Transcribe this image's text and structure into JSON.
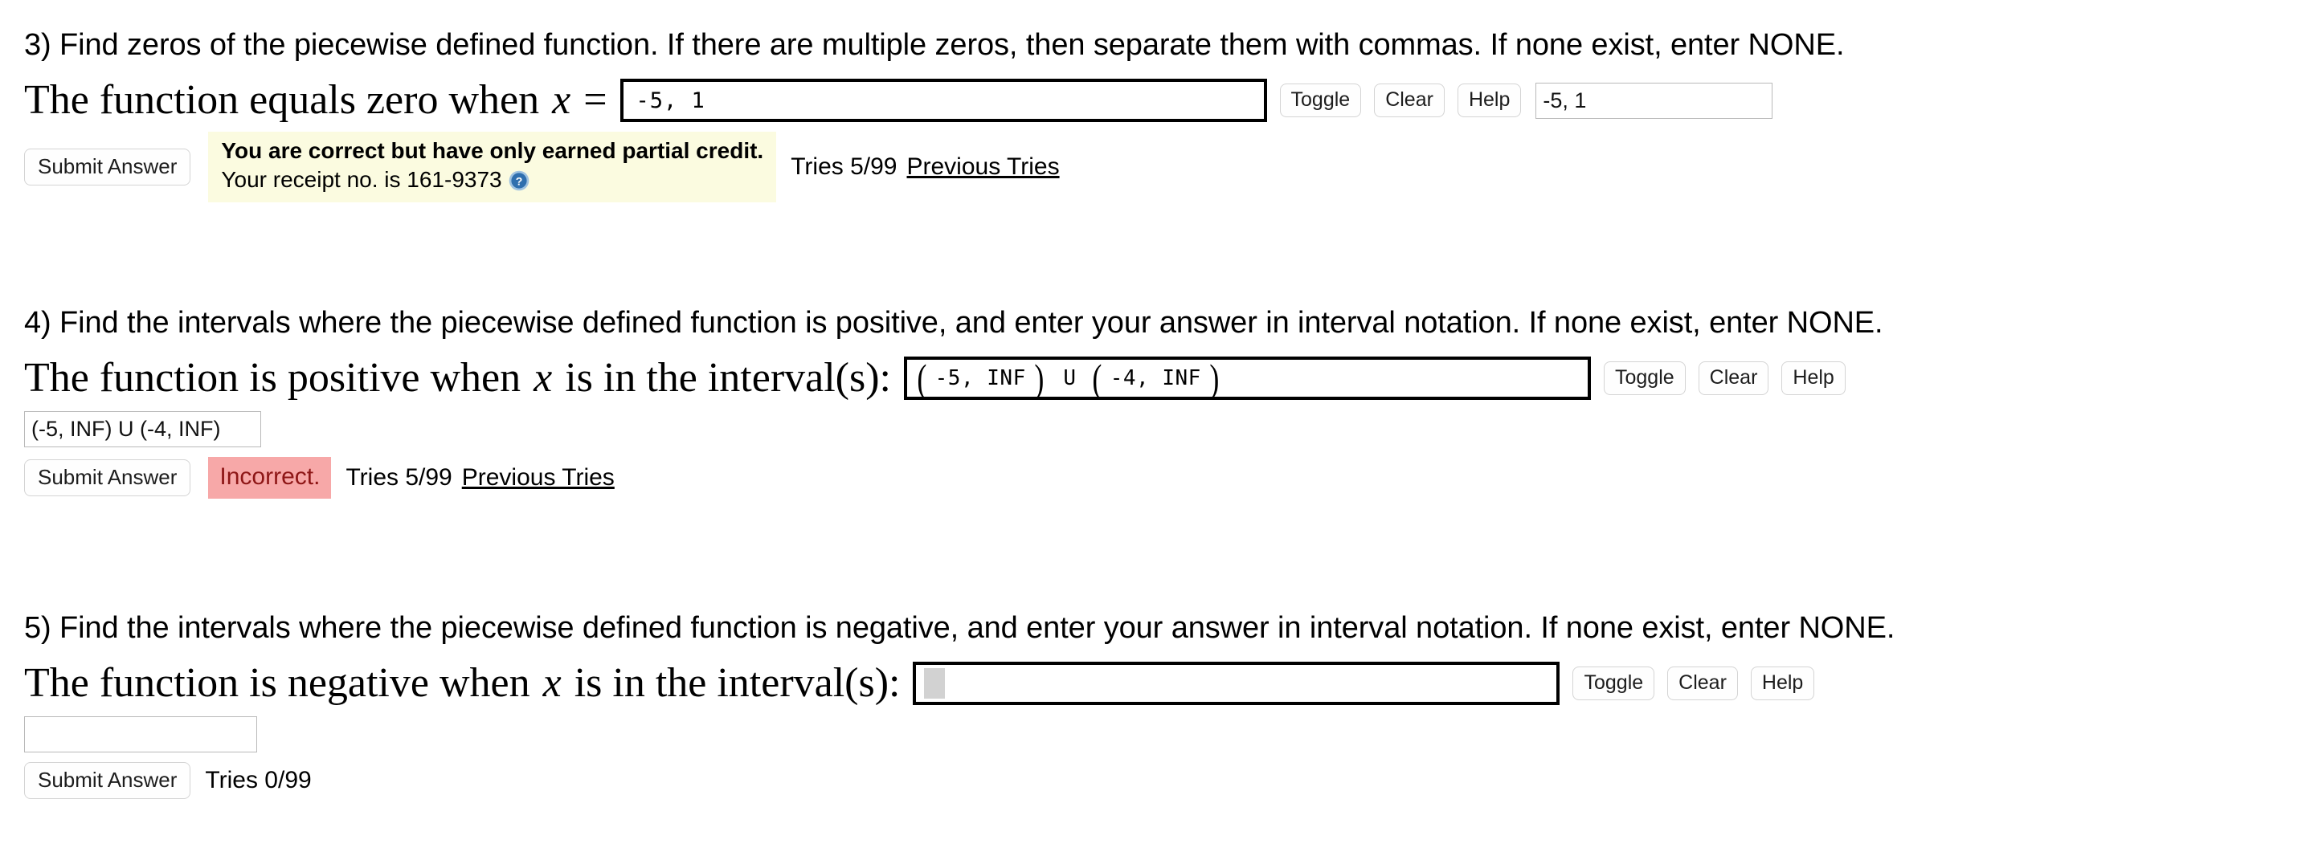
{
  "problems": [
    {
      "number": "3)",
      "statement": "3) Find zeros of the piecewise defined function. If there are multiple zeros, then separate them with commas. If none exist, enter NONE.",
      "prompt_prefix": "The function equals zero when",
      "prompt_var": "x",
      "prompt_suffix": "=",
      "answer_value": "-5, 1",
      "echo_value": "-5, 1",
      "buttons": {
        "toggle": "Toggle",
        "clear": "Clear",
        "help": "Help"
      },
      "submit_label": "Submit Answer",
      "feedback": {
        "kind": "partial-credit",
        "line1": "You are correct but have only earned partial credit.",
        "line2": "Your receipt no. is 161-9373",
        "icon": "help-circle-icon",
        "background_color": "#fbfbe0"
      },
      "tries": "Tries 5/99",
      "previous_tries": "Previous Tries"
    },
    {
      "number": "4)",
      "statement": "4) Find the intervals where the piecewise defined function is positive, and enter your answer in interval notation. If none exist, enter NONE.",
      "prompt_prefix": "The function is positive when",
      "prompt_var": "x",
      "prompt_suffix": "is in the interval(s):",
      "answer_parts": {
        "group1": "-5, INF",
        "operator": "U",
        "group2": "-4, INF"
      },
      "echo_value": "(-5, INF) U (-4, INF)",
      "buttons": {
        "toggle": "Toggle",
        "clear": "Clear",
        "help": "Help"
      },
      "submit_label": "Submit Answer",
      "feedback": {
        "kind": "incorrect",
        "line1": "Incorrect.",
        "background_color": "#f7a8a8",
        "text_color": "#8e1616"
      },
      "tries": "Tries 5/99",
      "previous_tries": "Previous Tries"
    },
    {
      "number": "5)",
      "statement": "5) Find the intervals where the piecewise defined function is negative, and enter your answer in interval notation. If none exist, enter NONE.",
      "prompt_prefix": "The function is negative when",
      "prompt_var": "x",
      "prompt_suffix": "is in the interval(s):",
      "answer_value": "",
      "echo_value": "",
      "buttons": {
        "toggle": "Toggle",
        "clear": "Clear",
        "help": "Help"
      },
      "submit_label": "Submit Answer",
      "tries": "Tries 0/99"
    }
  ]
}
